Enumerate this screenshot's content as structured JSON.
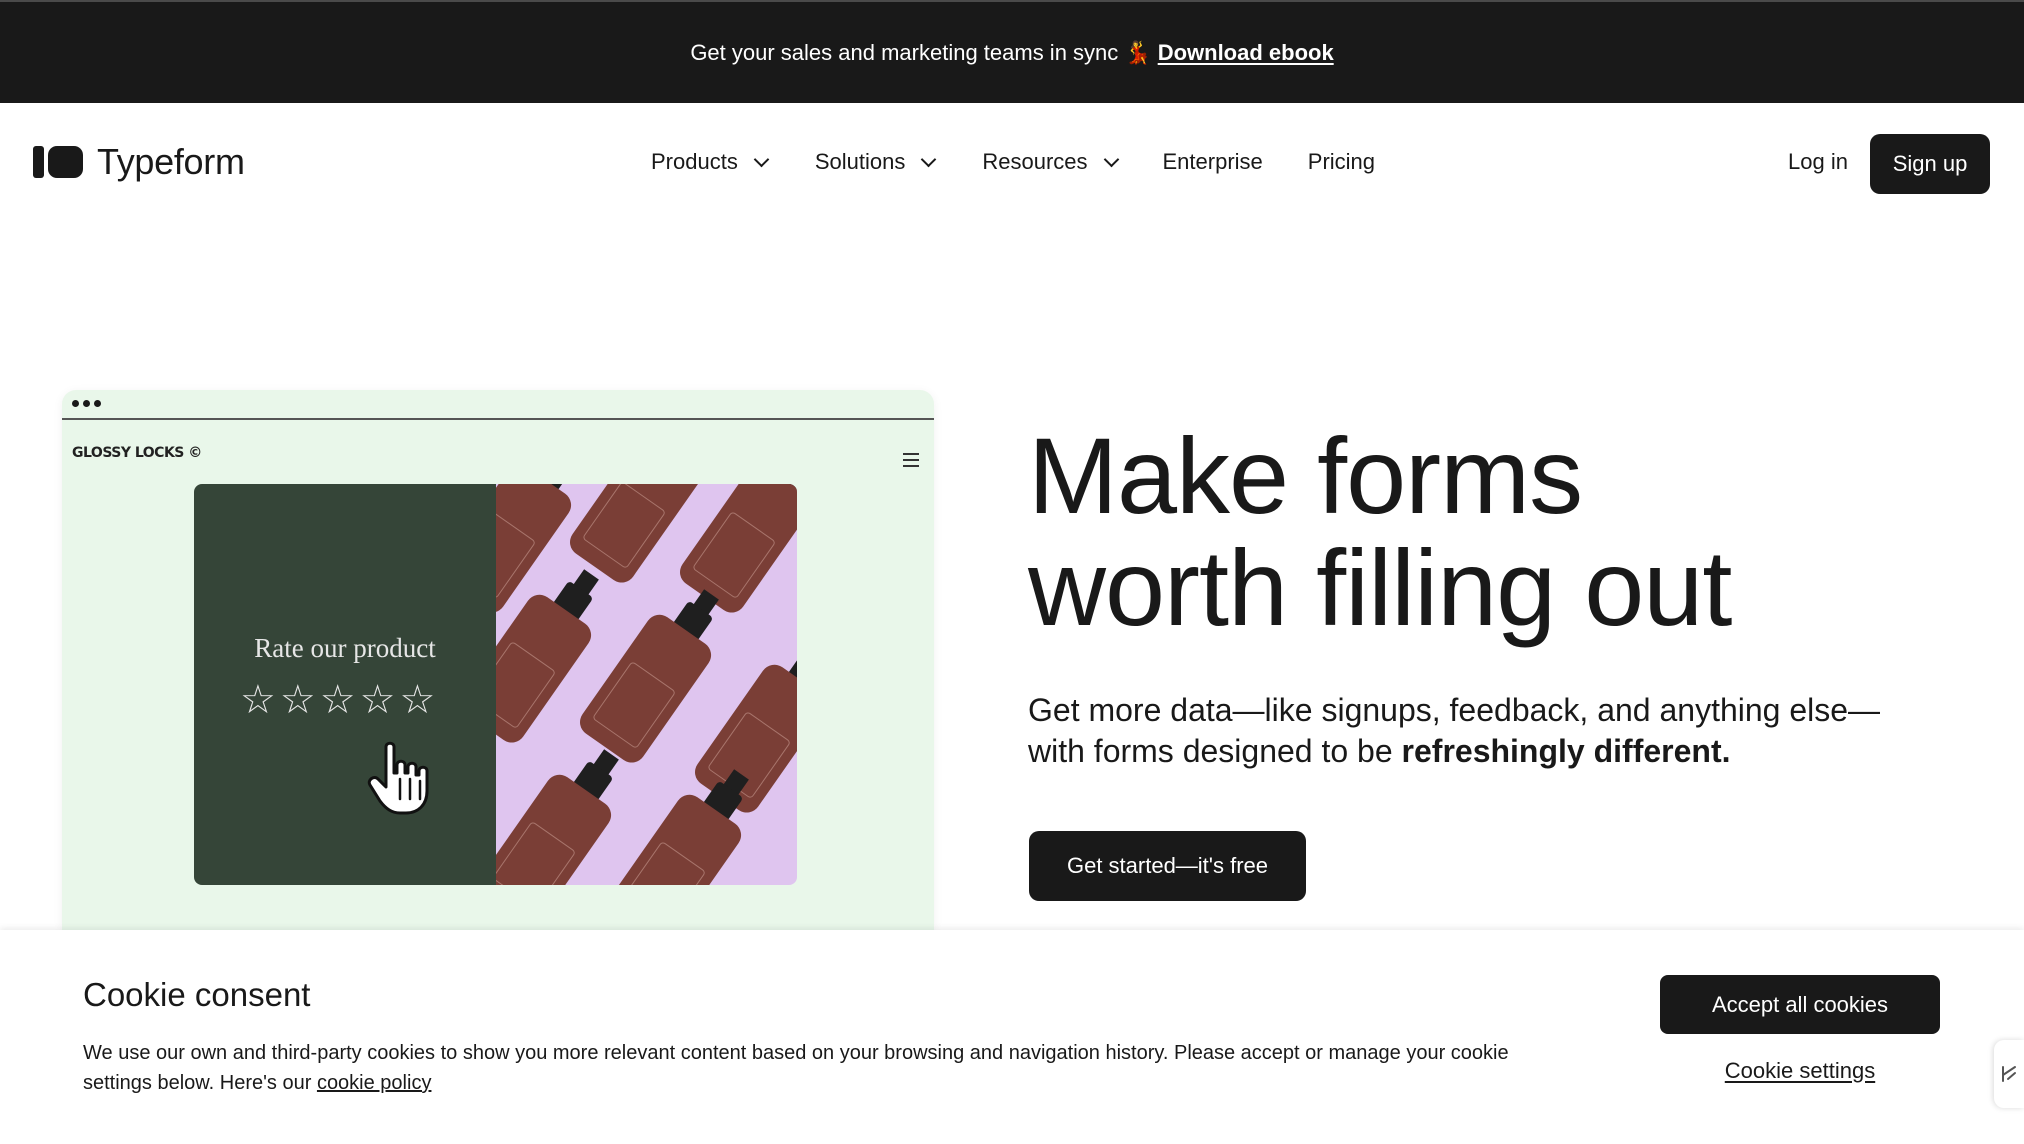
{
  "announcement": {
    "text": "Get your sales and marketing teams in sync",
    "emoji": "💃",
    "link": "Download ebook"
  },
  "header": {
    "logo": "Typeform",
    "nav": {
      "products": "Products",
      "solutions": "Solutions",
      "resources": "Resources",
      "enterprise": "Enterprise",
      "pricing": "Pricing"
    },
    "login": "Log in",
    "signup": "Sign up"
  },
  "mock": {
    "brand": "GLOSSY LOCKS ©",
    "rate_title": "Rate our product",
    "stars": [
      "☆",
      "☆",
      "☆",
      "☆",
      "☆"
    ]
  },
  "hero": {
    "title_line1": "Make forms",
    "title_line2": "worth filling out",
    "sub_text": "Get more data—like signups, feedback, and anything else—with forms designed to be ",
    "sub_bold": "refreshingly different.",
    "cta": "Get started—it's free"
  },
  "cookie": {
    "title": "Cookie consent",
    "text": "We use our own and third-party cookies to show you more relevant content based on your browsing and navigation history. Please accept or manage your cookie settings below. Here's our ",
    "policy_link": "cookie policy",
    "accept": "Accept all cookies",
    "settings": "Cookie settings"
  },
  "colors": {
    "dark": "#191919",
    "mock_bg": "#e9f7ea",
    "card_green": "#354538",
    "card_lilac": "#dfc5ef",
    "bottle": "#7a3e36"
  }
}
